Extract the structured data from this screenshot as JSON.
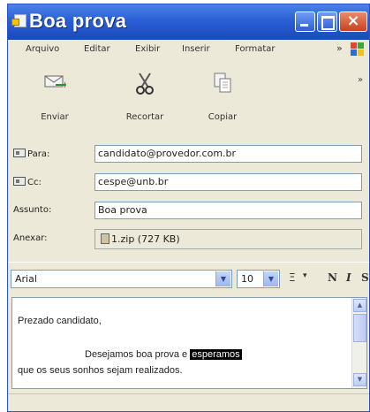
{
  "window": {
    "title": "Boa prova"
  },
  "menu": {
    "items": [
      "Arquivo",
      "Editar",
      "Exibir",
      "Inserir",
      "Formatar"
    ],
    "more": "»"
  },
  "toolbar": {
    "buttons": [
      {
        "label": "Enviar",
        "icon": "send-icon"
      },
      {
        "label": "Recortar",
        "icon": "scissors-icon"
      },
      {
        "label": "Copiar",
        "icon": "copy-icon"
      }
    ]
  },
  "fields": {
    "to_label": "Para:",
    "to_value": "candidato@provedor.com.br",
    "cc_label": "Cc:",
    "cc_value": "cespe@unb.br",
    "subject_label": "Assunto:",
    "subject_value": "Boa prova",
    "attach_label": "Anexar:",
    "attach_value": "1.zip (727 KB)"
  },
  "format": {
    "font": "Arial",
    "size": "10"
  },
  "body": {
    "line1": "Prezado candidato,",
    "line2_pre": "Desejamos boa prova e",
    "line2_hl": "esperamos",
    "line3": "que os seus sonhos sejam realizados."
  }
}
